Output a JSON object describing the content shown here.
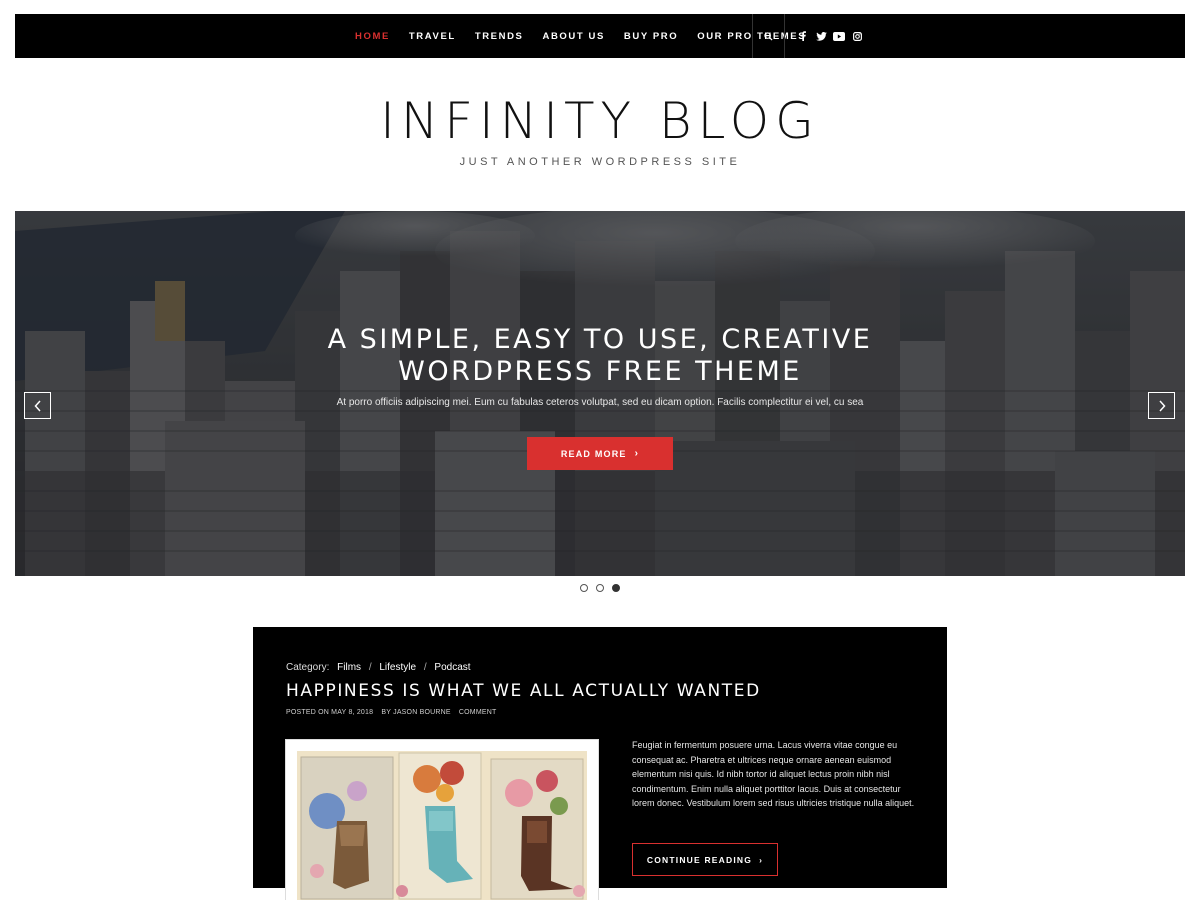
{
  "nav": {
    "items": [
      {
        "label": "HOME",
        "active": true
      },
      {
        "label": "TRAVEL",
        "active": false
      },
      {
        "label": "TRENDS",
        "active": false
      },
      {
        "label": "ABOUT US",
        "active": false
      },
      {
        "label": "BUY PRO",
        "active": false
      },
      {
        "label": "OUR PRO THEMES",
        "active": false
      }
    ],
    "search_icon": "search-icon",
    "social": [
      "facebook-icon",
      "twitter-icon",
      "youtube-icon",
      "instagram-icon"
    ]
  },
  "header": {
    "title": "INFINITY BLOG",
    "tagline": "JUST ANOTHER WORDPRESS SITE"
  },
  "hero": {
    "title_line1": "A SIMPLE, EASY TO USE, CREATIVE",
    "title_line2": "WORDPRESS FREE THEME",
    "excerpt": "At porro officiis adipiscing mei. Eum cu fabulas ceteros volutpat, sed eu dicam option. Facilis complectitur ei vel, cu sea",
    "button_label": "READ MORE",
    "slides_count": 3,
    "active_slide": 3
  },
  "post": {
    "category_label": "Category:",
    "categories": [
      "Films",
      "Lifestyle",
      "Podcast"
    ],
    "title": "HAPPINESS IS WHAT WE ALL ACTUALLY WANTED",
    "posted_on": "POSTED ON MAY 8, 2018",
    "author": "BY JASON BOURNE",
    "comment": "COMMENT",
    "excerpt": "Feugiat in fermentum posuere urna. Lacus viverra vitae congue eu consequat ac. Pharetra et ultrices neque ornare aenean euismod elementum nisi quis. Id nibh tortor id aliquet lectus proin nibh nisl condimentum. Enim nulla aliquet porttitor lacus. Duis at consectetur lorem donec. Vestibulum lorem sed risus ultricies tristique nulla aliquet.",
    "continue_label": "CONTINUE READING"
  },
  "colors": {
    "accent": "#d9302f",
    "nav_bg": "#000000",
    "post_bg": "#000000"
  }
}
